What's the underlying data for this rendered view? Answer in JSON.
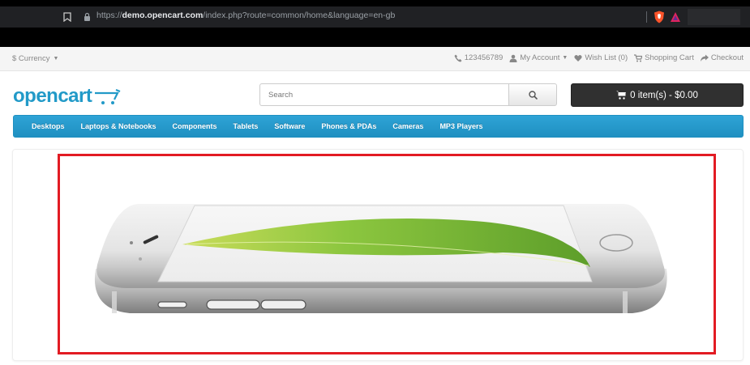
{
  "browser": {
    "url_prefix": "https://",
    "url_host": "demo.opencart.com",
    "url_path": "/index.php?route=common/home&language=en-gb"
  },
  "topbar": {
    "currency": "$ Currency",
    "phone": "123456789",
    "my_account": "My Account",
    "wish_list": "Wish List (0)",
    "shopping_cart": "Shopping Cart",
    "checkout": "Checkout"
  },
  "header": {
    "logo_text": "opencart",
    "search_placeholder": "Search",
    "cart_label": "0 item(s) - $0.00"
  },
  "menu": {
    "items": [
      "Desktops",
      "Laptops & Notebooks",
      "Components",
      "Tablets",
      "Software",
      "Phones & PDAs",
      "Cameras",
      "MP3 Players"
    ]
  },
  "colors": {
    "brand_blue": "#229ac8",
    "menu_blue": "#229ac8",
    "cart_button": "#303030",
    "highlight_red": "#e21b23"
  },
  "icons": {
    "bookmark": "bookmark-icon",
    "lock": "lock-icon",
    "shield": "brave-shield-icon",
    "rewards": "brave-rewards-icon",
    "phone": "phone-icon",
    "user": "user-icon",
    "heart": "heart-icon",
    "cart": "shopping-cart-icon",
    "share": "share-icon",
    "search": "search-icon"
  }
}
